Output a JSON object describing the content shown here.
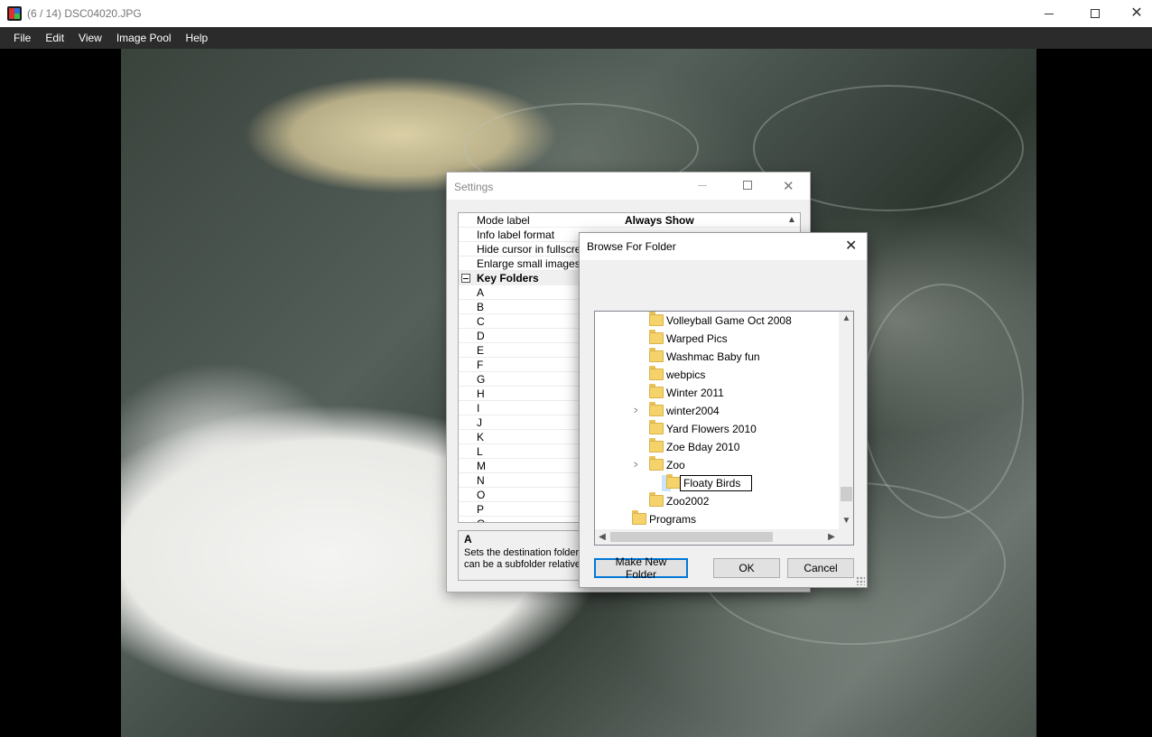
{
  "window": {
    "title": "(6 / 14) DSC04020.JPG"
  },
  "menu": [
    "File",
    "Edit",
    "View",
    "Image Pool",
    "Help"
  ],
  "settings": {
    "title": "Settings",
    "rows": [
      {
        "name": "Mode label",
        "value": "Always Show"
      },
      {
        "name": "Info label format",
        "value": ""
      },
      {
        "name": "Hide cursor in fullscreen",
        "value": ""
      },
      {
        "name": "Enlarge small images",
        "value": ""
      }
    ],
    "category": "Key Folders",
    "keys": [
      "A",
      "B",
      "C",
      "D",
      "E",
      "F",
      "G",
      "H",
      "I",
      "J",
      "K",
      "L",
      "M",
      "N",
      "O",
      "P",
      "Q"
    ],
    "description": {
      "title": "A",
      "line1": "Sets the destination folder w",
      "line2": "can be a subfolder relative t"
    }
  },
  "browse": {
    "title": "Browse For Folder",
    "items": [
      {
        "label": "Volleyball Game Oct 2008",
        "indent": 1,
        "expandable": false
      },
      {
        "label": "Warped Pics",
        "indent": 1,
        "expandable": false
      },
      {
        "label": "Washmac Baby fun",
        "indent": 1,
        "expandable": false
      },
      {
        "label": "webpics",
        "indent": 1,
        "expandable": false
      },
      {
        "label": "Winter 2011",
        "indent": 1,
        "expandable": false
      },
      {
        "label": "winter2004",
        "indent": 1,
        "expandable": true
      },
      {
        "label": "Yard Flowers 2010",
        "indent": 1,
        "expandable": false
      },
      {
        "label": "Zoe Bday 2010",
        "indent": 1,
        "expandable": false
      },
      {
        "label": "Zoo",
        "indent": 1,
        "expandable": true
      },
      {
        "label": "Floaty Birds",
        "indent": 2,
        "expandable": false,
        "editing": true
      },
      {
        "label": "Zoo2002",
        "indent": 1,
        "expandable": false
      },
      {
        "label": "Programs",
        "indent": 0,
        "expandable": false
      }
    ],
    "buttons": {
      "make_new_folder": "Make New Folder",
      "ok": "OK",
      "cancel": "Cancel"
    }
  }
}
